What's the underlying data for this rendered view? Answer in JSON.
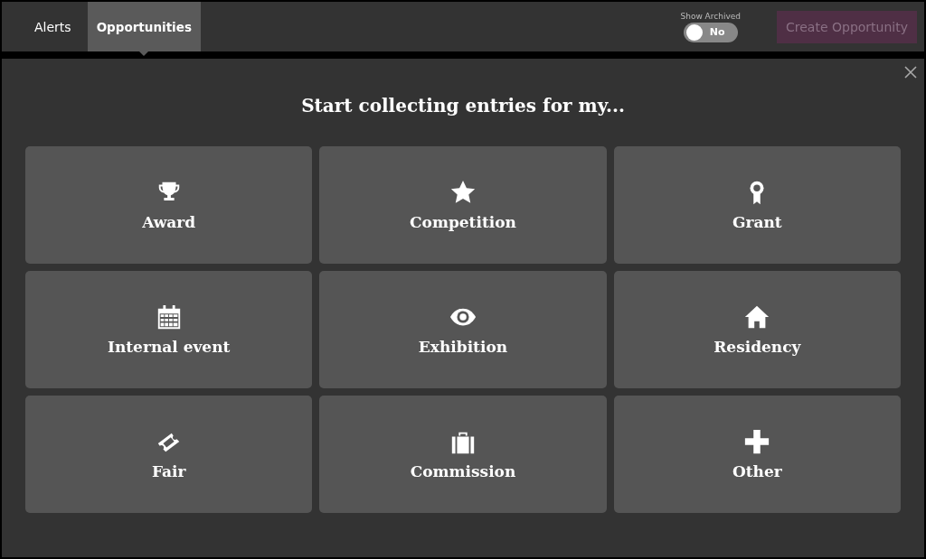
{
  "tabs": [
    {
      "label": "Alerts",
      "selected": false
    },
    {
      "label": "Opportunities",
      "selected": true
    }
  ],
  "show_archived": {
    "label": "Show Archived",
    "on": false,
    "value": "No"
  },
  "create_button": {
    "label": "Create Opportunity",
    "disabled": true
  },
  "dialog": {
    "title": "Start collecting entries for my...",
    "options": [
      {
        "label": "Award",
        "kind": "trophy"
      },
      {
        "label": "Competition",
        "kind": "star"
      },
      {
        "label": "Grant",
        "kind": "ribbon"
      },
      {
        "label": "Internal event",
        "kind": "calendar"
      },
      {
        "label": "Exhibition",
        "kind": "eye"
      },
      {
        "label": "Residency",
        "kind": "house"
      },
      {
        "label": "Fair",
        "kind": "ticket"
      },
      {
        "label": "Commission",
        "kind": "briefcase"
      },
      {
        "label": "Other",
        "kind": "plus"
      }
    ]
  }
}
